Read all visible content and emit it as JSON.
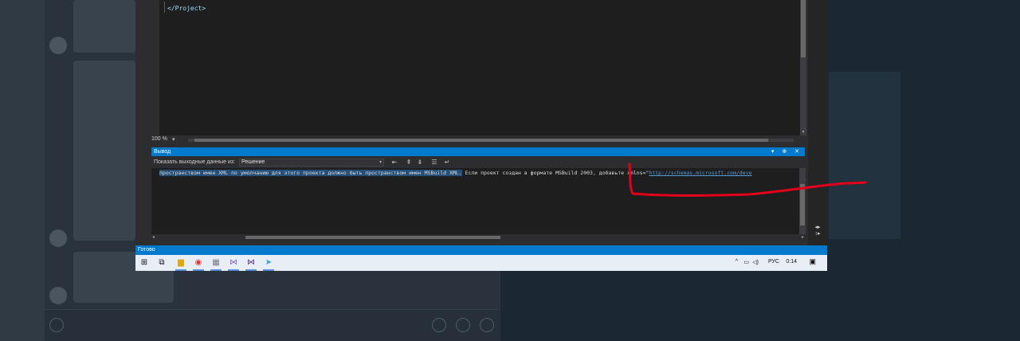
{
  "ide": {
    "editor_line": "</Project>",
    "zoom": "100 %",
    "output": {
      "title": "Вывод",
      "title_buttons": "▾ ⊕ ✕",
      "show_from_label": "Показать выходные данные из:",
      "source_selected": "Решение",
      "highlighted_text": "пространством имен XML по умолчанию для этого проекта должно быть пространством имен MSBuild XML.",
      "rest_text": " Если проект создан в формате MSBuild 2003, добавьте xmlns=\"",
      "link_text": "http://schemas.microsoft.com/deve"
    },
    "status": "Готово"
  },
  "taskbar": {
    "tray_language": "РУС",
    "tray_time": "0:14"
  },
  "colors": {
    "accent": "#007acc",
    "selection": "#264f78",
    "annotation": "#e3001b"
  }
}
